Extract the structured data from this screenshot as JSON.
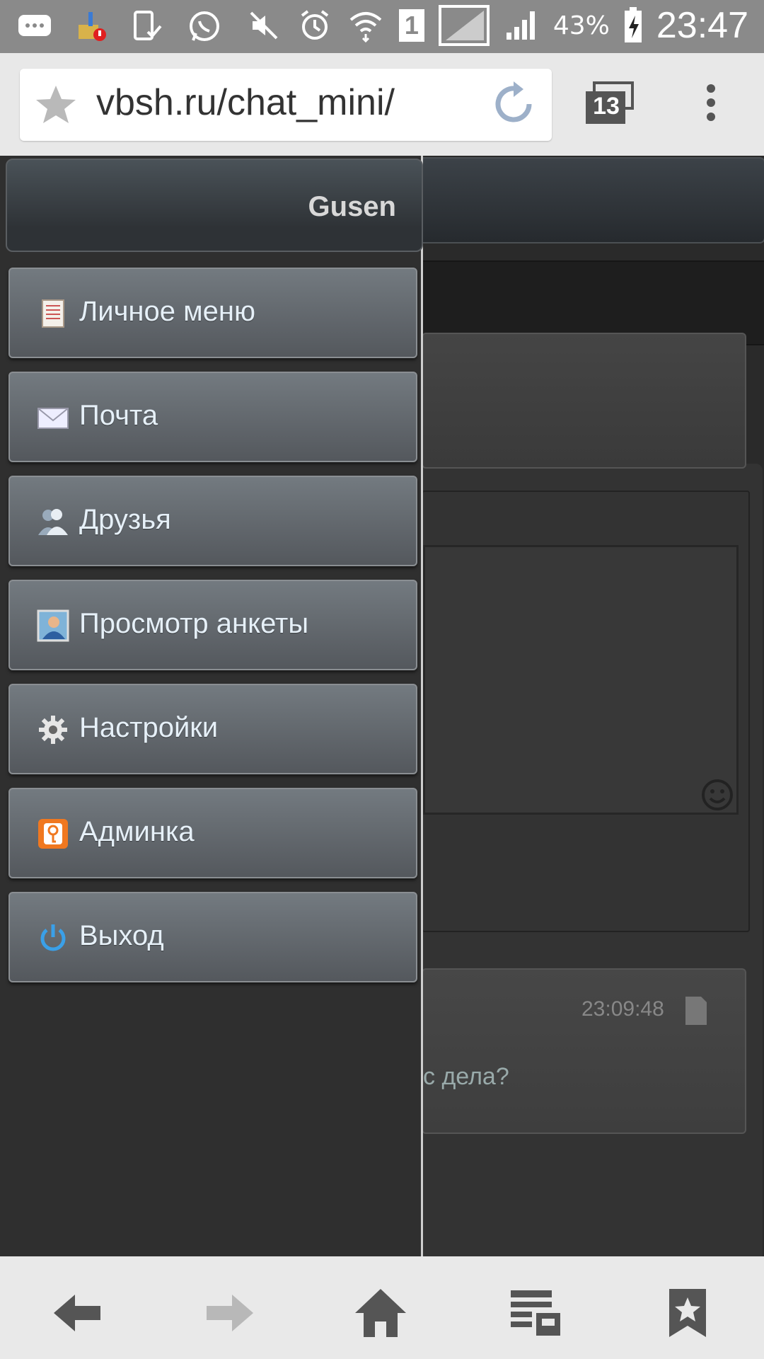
{
  "status_bar": {
    "battery_percent": "43%",
    "time": "23:47",
    "sim_slot": "1",
    "icons": [
      "message-icon",
      "cleaner-icon",
      "screen-check-icon",
      "whatsapp-icon",
      "mute-icon",
      "alarm-icon",
      "wifi-icon",
      "sim-icon",
      "no-signal-icon",
      "signal-icon",
      "battery-charging-icon"
    ]
  },
  "browser": {
    "url": "vbsh.ru/chat_mini/",
    "tab_count": "13",
    "icons": [
      "star-icon",
      "reload-icon",
      "tabs-icon",
      "more-icon"
    ]
  },
  "drawer": {
    "username": "Gusen",
    "items": [
      {
        "label": "Личное меню",
        "icon": "notepad-icon"
      },
      {
        "label": "Почта",
        "icon": "envelope-icon"
      },
      {
        "label": "Друзья",
        "icon": "friends-icon"
      },
      {
        "label": "Просмотр анкеты",
        "icon": "profile-card-icon"
      },
      {
        "label": "Настройки",
        "icon": "gear-icon"
      },
      {
        "label": "Админка",
        "icon": "admin-key-icon"
      },
      {
        "label": "Выход",
        "icon": "power-icon"
      }
    ]
  },
  "page": {
    "message_time": "23:09:48",
    "message_text": "с дела?"
  },
  "bottom_bar": {
    "icons": [
      "back-icon",
      "forward-icon",
      "home-icon",
      "reading-list-icon",
      "bookmarks-icon"
    ]
  }
}
